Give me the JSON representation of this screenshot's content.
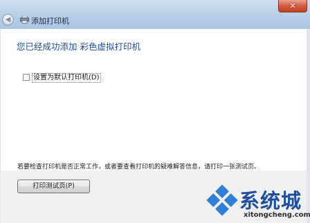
{
  "window": {
    "title": "添加打印机",
    "close_glyph": "✕",
    "back_glyph": "◀"
  },
  "main": {
    "headline": "您已经成功添加 彩色虚拟打印机",
    "default_printer_checkbox": {
      "label": "设置为默认打印机(D)",
      "checked": false
    },
    "info_text": "若要检查打印机是否正常工作，或者要查看打印机的疑难解答信息，请打印一张测试页。",
    "print_test_button": "打印测试页(P)"
  },
  "watermark": {
    "brand": "系统城",
    "url": "xitongcheng.com"
  },
  "colors": {
    "headline": "#1f4f8f",
    "watermark_blue": "#1c4f9c",
    "close_red": "#d2553a"
  },
  "icons": [
    "back-arrow-icon",
    "printer-icon",
    "close-icon",
    "windows-logo-icon"
  ]
}
